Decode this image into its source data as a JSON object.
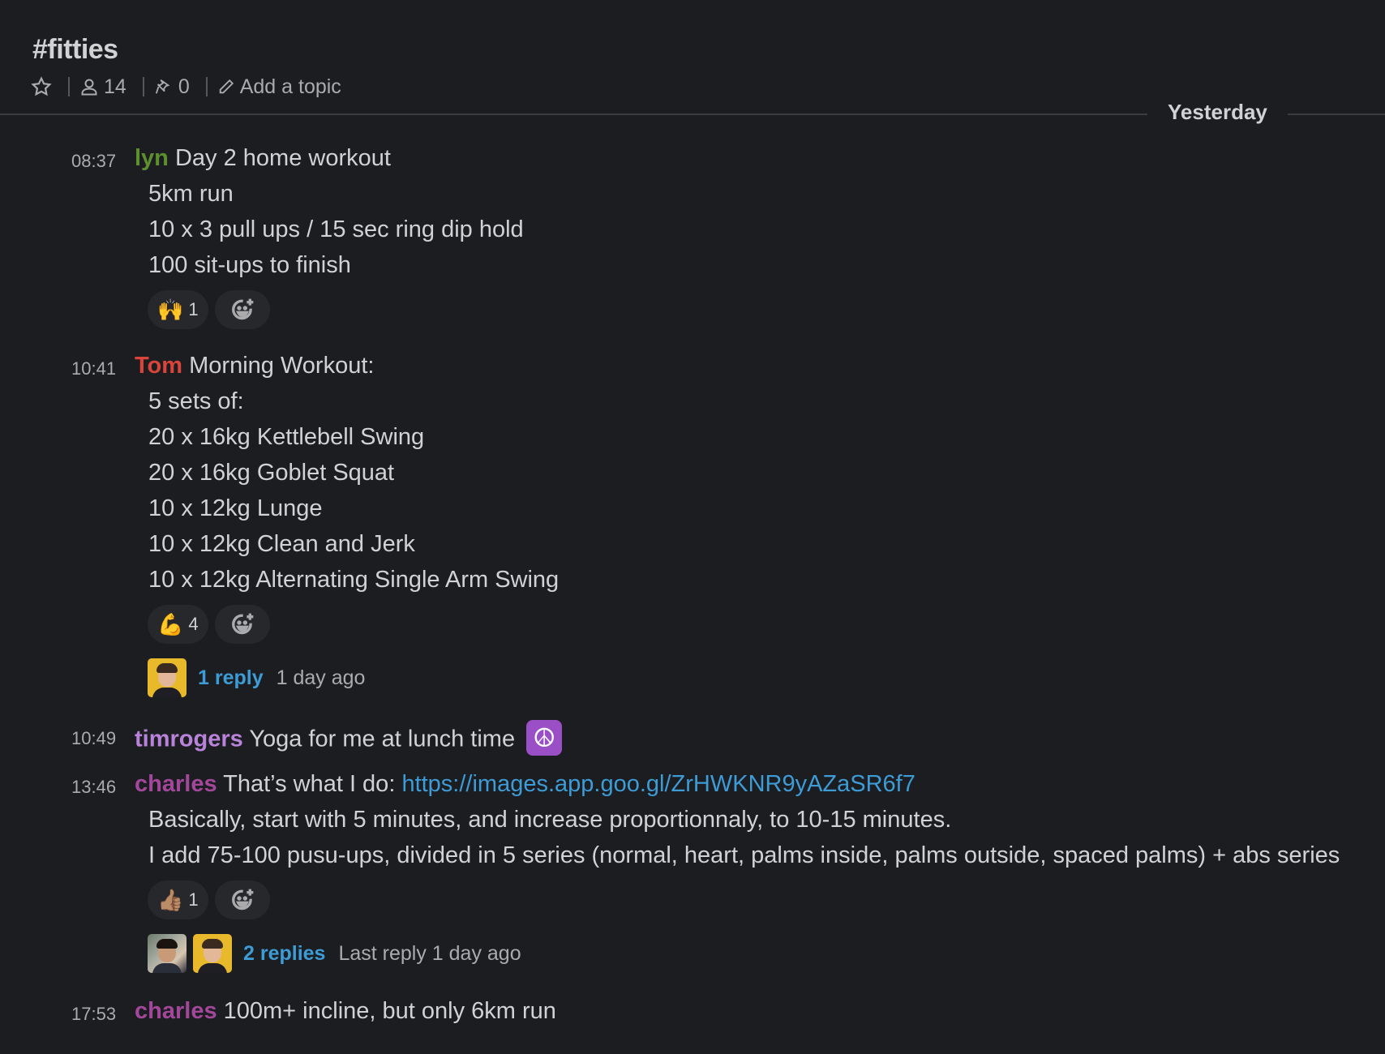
{
  "channel": {
    "title": "#fitties",
    "star_icon": "star-icon",
    "members_count": "14",
    "pins_count": "0",
    "topic_placeholder": "Add a topic"
  },
  "day_divider": "Yesterday",
  "colors": {
    "background": "#1b1d21",
    "text": "#d1d2d3",
    "muted": "#ababad",
    "link": "#3d9bd6",
    "user_lyn": "#5d8f2e",
    "user_tom": "#d9453a",
    "user_timrogers": "#b883d8",
    "user_charles": "#a2479a"
  },
  "messages": [
    {
      "time": "08:37",
      "user": "lyn",
      "first_line": "Day 2 home workout",
      "lines": [
        "5km run",
        "10 x 3 pull ups / 15 sec ring dip hold",
        "100 sit-ups to finish"
      ],
      "reactions": [
        {
          "emoji": "🙌",
          "icon": "raised-hands-emoji",
          "count": "1"
        }
      ]
    },
    {
      "time": "10:41",
      "user": "Tom",
      "first_line": "Morning Workout:",
      "lines": [
        "5 sets of:",
        "20 x 16kg Kettlebell Swing",
        "20 x 16kg Goblet Squat",
        "10 x 12kg Lunge",
        "10 x 12kg Clean and Jerk",
        "10 x 12kg Alternating Single Arm Swing"
      ],
      "reactions": [
        {
          "emoji": "💪",
          "icon": "flexed-biceps-emoji",
          "count": "4"
        }
      ],
      "thread": {
        "replies": "1 reply",
        "meta": "1 day ago"
      }
    },
    {
      "time": "10:49",
      "user": "timrogers",
      "first_line": "Yoga for me at lunch time",
      "emoji": "☮"
    },
    {
      "time": "13:46",
      "user": "charles",
      "first_line": "That’s what I do:",
      "link": "https://images.app.goo.gl/ZrHWKNR9yAZaSR6f7",
      "lines": [
        "Basically, start with 5 minutes, and increase proportionnaly, to 10-15 minutes.",
        "I add 75-100 pusu-ups, divided in 5 series (normal, heart, palms inside, palms outside, spaced palms) + abs series"
      ],
      "reactions": [
        {
          "emoji": "👍🏽",
          "icon": "thumbs-up-emoji",
          "count": "1"
        }
      ],
      "thread": {
        "replies": "2 replies",
        "meta": "Last reply 1 day ago"
      }
    },
    {
      "time": "17:53",
      "user": "charles",
      "first_line": "100m+ incline, but only 6km run"
    }
  ]
}
